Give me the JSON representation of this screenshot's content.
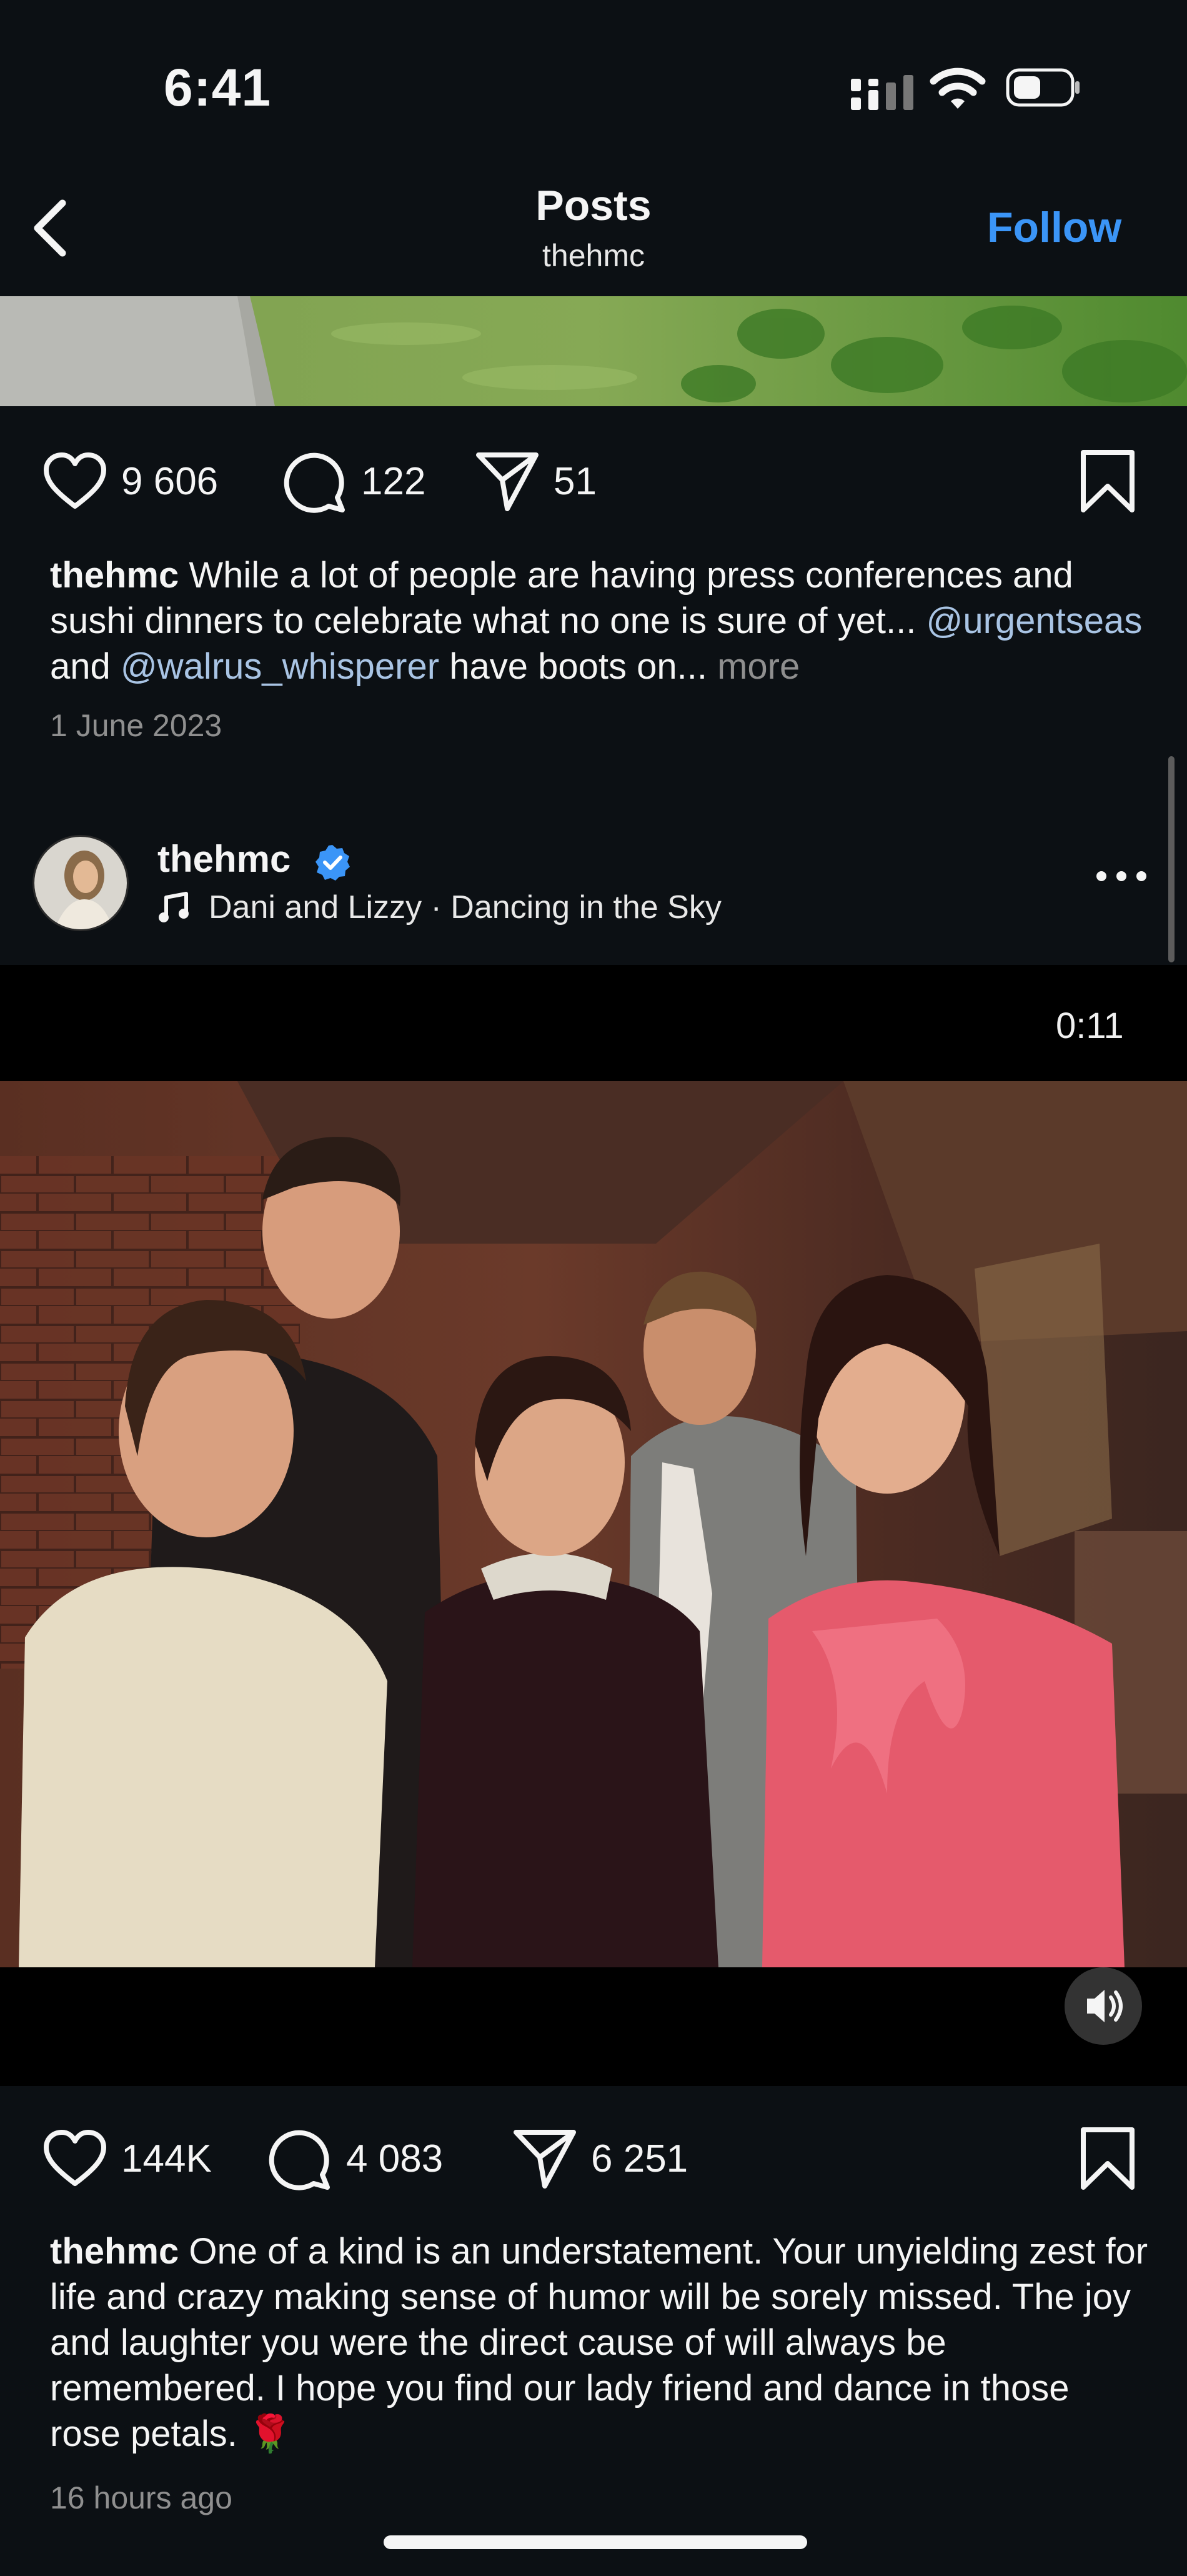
{
  "status_bar": {
    "time": "6:41"
  },
  "header": {
    "title": "Posts",
    "subtitle": "thehmc",
    "follow_label": "Follow"
  },
  "post1": {
    "likes": "9 606",
    "comments": "122",
    "shares": "51",
    "caption_user": "thehmc",
    "caption_text": "While a lot of people are having press conferences and sushi dinners to celebrate what no one is sure of yet...",
    "mention1": "@urgentseas",
    "conjunction": "and",
    "mention2": "@walrus_whisperer",
    "caption_tail": "have boots on...",
    "more_label": "more",
    "date": "1 June 2023"
  },
  "post2": {
    "username": "thehmc",
    "audio": "Dani and Lizzy · Dancing in the Sky",
    "video_time": "0:11",
    "likes": "144K",
    "comments": "4 083",
    "shares": "6 251",
    "caption_user": "thehmc",
    "caption_text": "One of a kind is an understatement. Your unyielding zest for life and crazy making sense of humor will be sorely missed. The joy and laughter you were the direct cause of will always be remembered. I hope you find our lady friend and dance in those rose petals.",
    "caption_emoji": "🌹",
    "time_ago": "16 hours ago"
  },
  "colors": {
    "background": "#0c1014",
    "follow": "#3b95f7",
    "mention": "#a9c4e4",
    "muted": "#8f8f8f",
    "verified": "#3b95f7"
  },
  "icons": [
    "back-chevron-icon",
    "heart-icon",
    "comment-icon",
    "share-icon",
    "bookmark-icon",
    "verified-icon",
    "music-note-icon",
    "more-dots-icon",
    "volume-icon"
  ]
}
